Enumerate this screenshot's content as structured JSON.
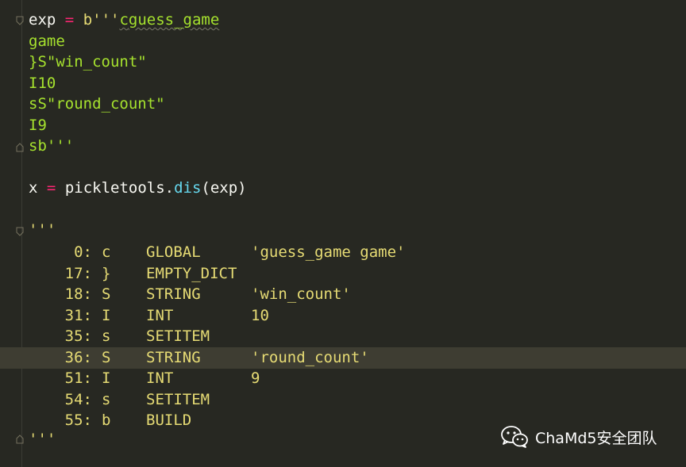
{
  "code": {
    "line1": {
      "var": "exp",
      "op": "=",
      "prefix": "b'''",
      "cmd": "c",
      "rest": "guess_game"
    },
    "line2": "game",
    "line3": "}S\"win_count\"",
    "line4": "I10",
    "line5": "sS\"round_count\"",
    "line6": "I9",
    "line7": "sb'''",
    "line9": {
      "var": "x",
      "op": "=",
      "module": "pickletools.",
      "func": "dis",
      "args": "(exp)"
    },
    "line11": "'''",
    "line_end": "'''"
  },
  "disassembly": [
    {
      "offset": "0:",
      "opcode": "c",
      "name": "GLOBAL",
      "arg": "'guess_game game'"
    },
    {
      "offset": "17:",
      "opcode": "}",
      "name": "EMPTY_DICT",
      "arg": ""
    },
    {
      "offset": "18:",
      "opcode": "S",
      "name": "STRING",
      "arg": "'win_count'"
    },
    {
      "offset": "31:",
      "opcode": "I",
      "name": "INT",
      "arg": "10"
    },
    {
      "offset": "35:",
      "opcode": "s",
      "name": "SETITEM",
      "arg": ""
    },
    {
      "offset": "36:",
      "opcode": "S",
      "name": "STRING",
      "arg": "'round_count'"
    },
    {
      "offset": "51:",
      "opcode": "I",
      "name": "INT",
      "arg": "9"
    },
    {
      "offset": "54:",
      "opcode": "s",
      "name": "SETITEM",
      "arg": ""
    },
    {
      "offset": "55:",
      "opcode": "b",
      "name": "BUILD",
      "arg": ""
    }
  ],
  "watermark": {
    "text": "ChaMd5安全团队",
    "icon": "wechat-icon"
  },
  "colors": {
    "background": "#272822",
    "keyword": "#f92672",
    "string": "#e6db74",
    "function": "#66d9ef",
    "highlight": "#3e3d32"
  }
}
